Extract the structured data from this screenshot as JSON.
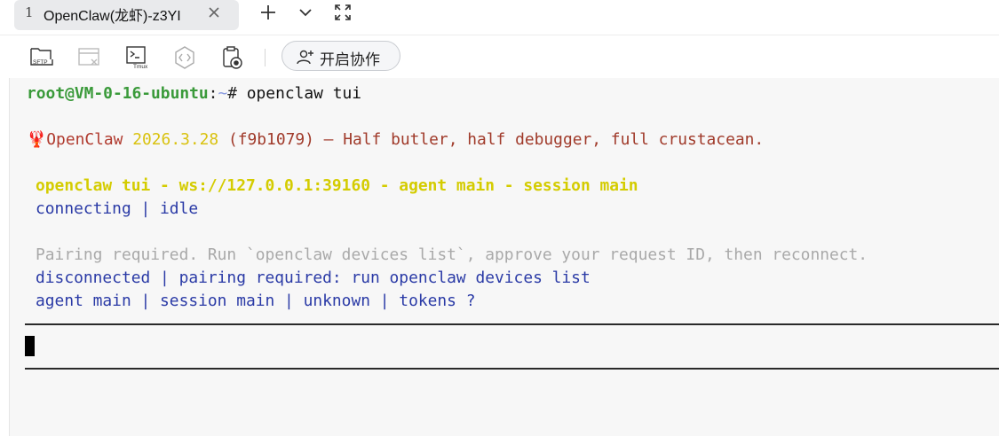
{
  "tab": {
    "number": "1",
    "title": "OpenClaw(龙虾)-z3YI"
  },
  "toolbar": {
    "sftp_label": "SFTP",
    "tmux_label": "Tmux",
    "collab_label": "开启协作"
  },
  "terminal": {
    "prompt_user": "root@VM-0-16-ubuntu",
    "prompt_sep": ":",
    "prompt_path": "~",
    "prompt_hash": "# ",
    "command": "openclaw tui",
    "banner_emoji": "🦞",
    "banner_name": "OpenClaw",
    "banner_version": "2026.3.28",
    "banner_rest": "(f9b1079) — Half butler, half debugger, full crustacean.",
    "status_header": "openclaw tui - ws://127.0.0.1:39160 - agent main - session main",
    "status_connecting": "connecting | idle",
    "pairing_msg": "Pairing required. Run `openclaw devices list`, approve your request ID, then reconnect.",
    "disconnected_line": "disconnected | pairing required: run openclaw devices list",
    "footer_line": "agent main | session main | unknown | tokens ?"
  },
  "colors": {
    "prompt_green": "#3a9a3a",
    "path_blue": "#8a9be0",
    "banner_red": "#b03a2e",
    "banner_yellow": "#d9c20f",
    "status_yellow": "#d4cc00",
    "info_blue": "#2a3aa6",
    "muted_gray": "#a9a9a9"
  }
}
